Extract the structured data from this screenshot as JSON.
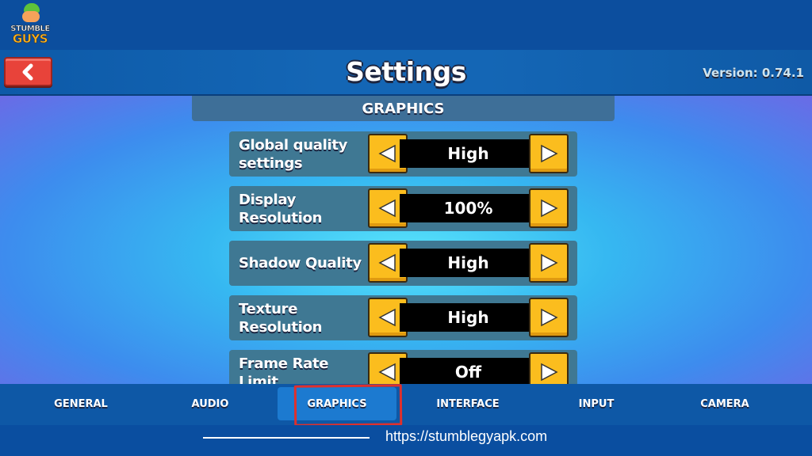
{
  "app": {
    "logo_line1": "STUMBLE",
    "logo_line2": "GUYS"
  },
  "header": {
    "title": "Settings",
    "version": "Version: 0.74.1",
    "back_icon": "chevron-left-icon"
  },
  "section": {
    "title": "GRAPHICS"
  },
  "settings": [
    {
      "label": "Global quality settings",
      "value": "High"
    },
    {
      "label": "Display Resolution",
      "value": "100%"
    },
    {
      "label": "Shadow Quality",
      "value": "High"
    },
    {
      "label": "Texture Resolution",
      "value": "High"
    },
    {
      "label": "Frame Rate Limit",
      "value": "Off"
    }
  ],
  "tabs": [
    {
      "label": "GENERAL",
      "active": false
    },
    {
      "label": "AUDIO",
      "active": false
    },
    {
      "label": "GRAPHICS",
      "active": true
    },
    {
      "label": "INTERFACE",
      "active": false
    },
    {
      "label": "INPUT",
      "active": false
    },
    {
      "label": "CAMERA",
      "active": false
    }
  ],
  "footer": {
    "url": "https://stumblegyapk.com"
  },
  "colors": {
    "arrow_button": "#fbbd1e",
    "back_button": "#e8433a",
    "active_tab": "#1c7ad0",
    "annotation": "#e0302c"
  }
}
